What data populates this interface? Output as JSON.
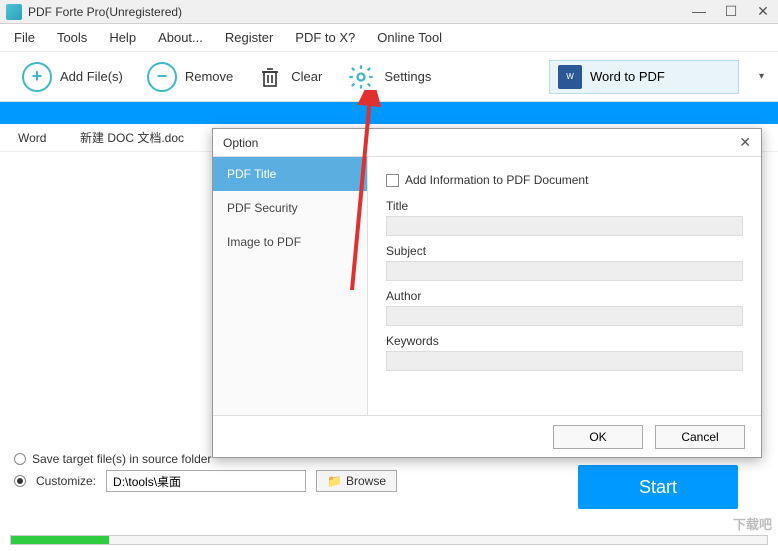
{
  "window": {
    "title": "PDF Forte Pro(Unregistered)"
  },
  "menu": {
    "file": "File",
    "tools": "Tools",
    "help": "Help",
    "about": "About...",
    "register": "Register",
    "pdftox": "PDF to X?",
    "online": "Online Tool"
  },
  "toolbar": {
    "addfiles": "Add File(s)",
    "remove": "Remove",
    "clear": "Clear",
    "settings": "Settings"
  },
  "mode": {
    "label": "Word to PDF"
  },
  "filelist": {
    "col1": "Word",
    "filename": "新建 DOC 文档.doc"
  },
  "output": {
    "save_source": "Save target file(s) in source folder",
    "customize": "Customize:",
    "path": "D:\\tools\\桌面",
    "browse": "Browse"
  },
  "start": "Start",
  "dialog": {
    "title": "Option",
    "tabs": {
      "pdf_title": "PDF Title",
      "pdf_security": "PDF Security",
      "image_to_pdf": "Image to PDF"
    },
    "check_label": "Add Information to PDF Document",
    "fields": {
      "title": "Title",
      "subject": "Subject",
      "author": "Author",
      "keywords": "Keywords"
    },
    "ok": "OK",
    "cancel": "Cancel"
  },
  "watermark": "下载吧"
}
